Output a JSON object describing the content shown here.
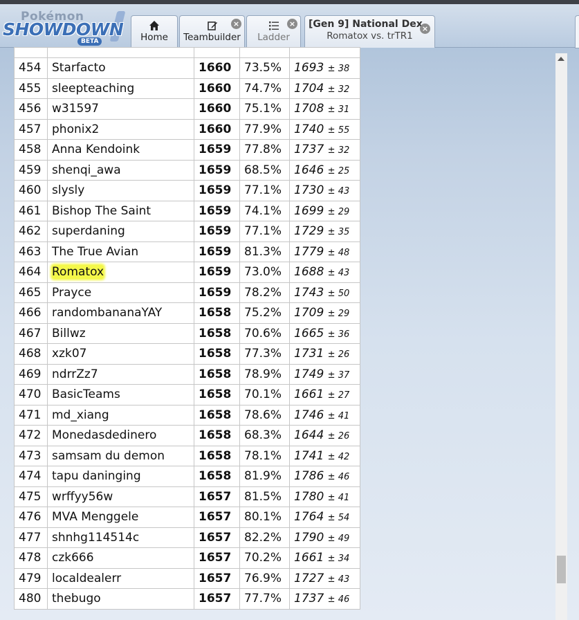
{
  "logo": {
    "brand_top": "Pokémon",
    "brand_main": "SHOWDOWN",
    "badge": "BETA"
  },
  "tabs": {
    "home": {
      "label": "Home",
      "icon": "home-icon"
    },
    "teambuilder": {
      "label": "Teambuilder",
      "icon": "edit-icon"
    },
    "ladder": {
      "label": "Ladder",
      "icon": "list-icon"
    },
    "battle": {
      "title": "[Gen 9] National Dex",
      "subtitle": "Romatox vs. trTR1"
    },
    "close_glyph": "×"
  },
  "ladder": {
    "highlight_color": "#f4f84a",
    "rows": [
      {
        "rank": "454",
        "name": "Starfacto",
        "elo": "1660",
        "gxe": "73.5%",
        "glicko": "1693",
        "dev": "± 38"
      },
      {
        "rank": "455",
        "name": "sleepteaching",
        "elo": "1660",
        "gxe": "74.7%",
        "glicko": "1704",
        "dev": "± 32"
      },
      {
        "rank": "456",
        "name": "w31597",
        "elo": "1660",
        "gxe": "75.1%",
        "glicko": "1708",
        "dev": "± 31"
      },
      {
        "rank": "457",
        "name": "phonix2",
        "elo": "1660",
        "gxe": "77.9%",
        "glicko": "1740",
        "dev": "± 55"
      },
      {
        "rank": "458",
        "name": "Anna Kendoink",
        "elo": "1659",
        "gxe": "77.8%",
        "glicko": "1737",
        "dev": "± 32"
      },
      {
        "rank": "459",
        "name": "shenqi_awa",
        "elo": "1659",
        "gxe": "68.5%",
        "glicko": "1646",
        "dev": "± 25"
      },
      {
        "rank": "460",
        "name": "slysly",
        "elo": "1659",
        "gxe": "77.1%",
        "glicko": "1730",
        "dev": "± 43"
      },
      {
        "rank": "461",
        "name": "Bishop The Saint",
        "elo": "1659",
        "gxe": "74.1%",
        "glicko": "1699",
        "dev": "± 29"
      },
      {
        "rank": "462",
        "name": "superdaning",
        "elo": "1659",
        "gxe": "77.1%",
        "glicko": "1729",
        "dev": "± 35"
      },
      {
        "rank": "463",
        "name": "The True Avian",
        "elo": "1659",
        "gxe": "81.3%",
        "glicko": "1779",
        "dev": "± 48"
      },
      {
        "rank": "464",
        "name": "Romatox",
        "elo": "1659",
        "gxe": "73.0%",
        "glicko": "1688",
        "dev": "± 43",
        "highlight": true
      },
      {
        "rank": "465",
        "name": "Prayce",
        "elo": "1659",
        "gxe": "78.2%",
        "glicko": "1743",
        "dev": "± 50"
      },
      {
        "rank": "466",
        "name": "randombananaYAY",
        "elo": "1658",
        "gxe": "75.2%",
        "glicko": "1709",
        "dev": "± 29"
      },
      {
        "rank": "467",
        "name": "Billwz",
        "elo": "1658",
        "gxe": "70.6%",
        "glicko": "1665",
        "dev": "± 36"
      },
      {
        "rank": "468",
        "name": "xzk07",
        "elo": "1658",
        "gxe": "77.3%",
        "glicko": "1731",
        "dev": "± 26"
      },
      {
        "rank": "469",
        "name": "ndrrZz7",
        "elo": "1658",
        "gxe": "78.9%",
        "glicko": "1749",
        "dev": "± 37"
      },
      {
        "rank": "470",
        "name": "BasicTeams",
        "elo": "1658",
        "gxe": "70.1%",
        "glicko": "1661",
        "dev": "± 27"
      },
      {
        "rank": "471",
        "name": "md_xiang",
        "elo": "1658",
        "gxe": "78.6%",
        "glicko": "1746",
        "dev": "± 41"
      },
      {
        "rank": "472",
        "name": "Monedasdedinero",
        "elo": "1658",
        "gxe": "68.3%",
        "glicko": "1644",
        "dev": "± 26"
      },
      {
        "rank": "473",
        "name": "samsam du demon",
        "elo": "1658",
        "gxe": "78.1%",
        "glicko": "1741",
        "dev": "± 42"
      },
      {
        "rank": "474",
        "name": "tapu daninging",
        "elo": "1658",
        "gxe": "81.9%",
        "glicko": "1786",
        "dev": "± 46"
      },
      {
        "rank": "475",
        "name": "wrffyy56w",
        "elo": "1657",
        "gxe": "81.5%",
        "glicko": "1780",
        "dev": "± 41"
      },
      {
        "rank": "476",
        "name": "MVA Menggele",
        "elo": "1657",
        "gxe": "80.1%",
        "glicko": "1764",
        "dev": "± 54"
      },
      {
        "rank": "477",
        "name": "shnhg114514c",
        "elo": "1657",
        "gxe": "82.2%",
        "glicko": "1790",
        "dev": "± 49"
      },
      {
        "rank": "478",
        "name": "czk666",
        "elo": "1657",
        "gxe": "70.2%",
        "glicko": "1661",
        "dev": "± 34"
      },
      {
        "rank": "479",
        "name": "localdealerr",
        "elo": "1657",
        "gxe": "76.9%",
        "glicko": "1727",
        "dev": "± 43"
      },
      {
        "rank": "480",
        "name": "thebugo",
        "elo": "1657",
        "gxe": "77.7%",
        "glicko": "1737",
        "dev": "± 46"
      }
    ]
  },
  "scrollbar": {
    "position": 0.93
  }
}
